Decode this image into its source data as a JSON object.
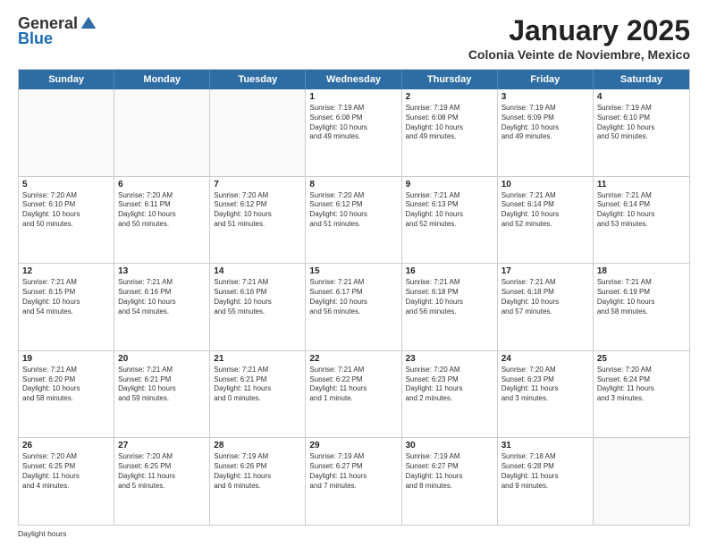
{
  "logo": {
    "general": "General",
    "blue": "Blue"
  },
  "title": "January 2025",
  "location": "Colonia Veinte de Noviembre, Mexico",
  "days": [
    "Sunday",
    "Monday",
    "Tuesday",
    "Wednesday",
    "Thursday",
    "Friday",
    "Saturday"
  ],
  "weeks": [
    [
      {
        "day": "",
        "info": ""
      },
      {
        "day": "",
        "info": ""
      },
      {
        "day": "",
        "info": ""
      },
      {
        "day": "1",
        "info": "Sunrise: 7:19 AM\nSunset: 6:08 PM\nDaylight: 10 hours\nand 49 minutes."
      },
      {
        "day": "2",
        "info": "Sunrise: 7:19 AM\nSunset: 6:08 PM\nDaylight: 10 hours\nand 49 minutes."
      },
      {
        "day": "3",
        "info": "Sunrise: 7:19 AM\nSunset: 6:09 PM\nDaylight: 10 hours\nand 49 minutes."
      },
      {
        "day": "4",
        "info": "Sunrise: 7:19 AM\nSunset: 6:10 PM\nDaylight: 10 hours\nand 50 minutes."
      }
    ],
    [
      {
        "day": "5",
        "info": "Sunrise: 7:20 AM\nSunset: 6:10 PM\nDaylight: 10 hours\nand 50 minutes."
      },
      {
        "day": "6",
        "info": "Sunrise: 7:20 AM\nSunset: 6:11 PM\nDaylight: 10 hours\nand 50 minutes."
      },
      {
        "day": "7",
        "info": "Sunrise: 7:20 AM\nSunset: 6:12 PM\nDaylight: 10 hours\nand 51 minutes."
      },
      {
        "day": "8",
        "info": "Sunrise: 7:20 AM\nSunset: 6:12 PM\nDaylight: 10 hours\nand 51 minutes."
      },
      {
        "day": "9",
        "info": "Sunrise: 7:21 AM\nSunset: 6:13 PM\nDaylight: 10 hours\nand 52 minutes."
      },
      {
        "day": "10",
        "info": "Sunrise: 7:21 AM\nSunset: 6:14 PM\nDaylight: 10 hours\nand 52 minutes."
      },
      {
        "day": "11",
        "info": "Sunrise: 7:21 AM\nSunset: 6:14 PM\nDaylight: 10 hours\nand 53 minutes."
      }
    ],
    [
      {
        "day": "12",
        "info": "Sunrise: 7:21 AM\nSunset: 6:15 PM\nDaylight: 10 hours\nand 54 minutes."
      },
      {
        "day": "13",
        "info": "Sunrise: 7:21 AM\nSunset: 6:16 PM\nDaylight: 10 hours\nand 54 minutes."
      },
      {
        "day": "14",
        "info": "Sunrise: 7:21 AM\nSunset: 6:16 PM\nDaylight: 10 hours\nand 55 minutes."
      },
      {
        "day": "15",
        "info": "Sunrise: 7:21 AM\nSunset: 6:17 PM\nDaylight: 10 hours\nand 56 minutes."
      },
      {
        "day": "16",
        "info": "Sunrise: 7:21 AM\nSunset: 6:18 PM\nDaylight: 10 hours\nand 56 minutes."
      },
      {
        "day": "17",
        "info": "Sunrise: 7:21 AM\nSunset: 6:18 PM\nDaylight: 10 hours\nand 57 minutes."
      },
      {
        "day": "18",
        "info": "Sunrise: 7:21 AM\nSunset: 6:19 PM\nDaylight: 10 hours\nand 58 minutes."
      }
    ],
    [
      {
        "day": "19",
        "info": "Sunrise: 7:21 AM\nSunset: 6:20 PM\nDaylight: 10 hours\nand 58 minutes."
      },
      {
        "day": "20",
        "info": "Sunrise: 7:21 AM\nSunset: 6:21 PM\nDaylight: 10 hours\nand 59 minutes."
      },
      {
        "day": "21",
        "info": "Sunrise: 7:21 AM\nSunset: 6:21 PM\nDaylight: 11 hours\nand 0 minutes."
      },
      {
        "day": "22",
        "info": "Sunrise: 7:21 AM\nSunset: 6:22 PM\nDaylight: 11 hours\nand 1 minute."
      },
      {
        "day": "23",
        "info": "Sunrise: 7:20 AM\nSunset: 6:23 PM\nDaylight: 11 hours\nand 2 minutes."
      },
      {
        "day": "24",
        "info": "Sunrise: 7:20 AM\nSunset: 6:23 PM\nDaylight: 11 hours\nand 3 minutes."
      },
      {
        "day": "25",
        "info": "Sunrise: 7:20 AM\nSunset: 6:24 PM\nDaylight: 11 hours\nand 3 minutes."
      }
    ],
    [
      {
        "day": "26",
        "info": "Sunrise: 7:20 AM\nSunset: 6:25 PM\nDaylight: 11 hours\nand 4 minutes."
      },
      {
        "day": "27",
        "info": "Sunrise: 7:20 AM\nSunset: 6:25 PM\nDaylight: 11 hours\nand 5 minutes."
      },
      {
        "day": "28",
        "info": "Sunrise: 7:19 AM\nSunset: 6:26 PM\nDaylight: 11 hours\nand 6 minutes."
      },
      {
        "day": "29",
        "info": "Sunrise: 7:19 AM\nSunset: 6:27 PM\nDaylight: 11 hours\nand 7 minutes."
      },
      {
        "day": "30",
        "info": "Sunrise: 7:19 AM\nSunset: 6:27 PM\nDaylight: 11 hours\nand 8 minutes."
      },
      {
        "day": "31",
        "info": "Sunrise: 7:18 AM\nSunset: 6:28 PM\nDaylight: 11 hours\nand 9 minutes."
      },
      {
        "day": "",
        "info": ""
      }
    ]
  ],
  "footer": "Daylight hours"
}
